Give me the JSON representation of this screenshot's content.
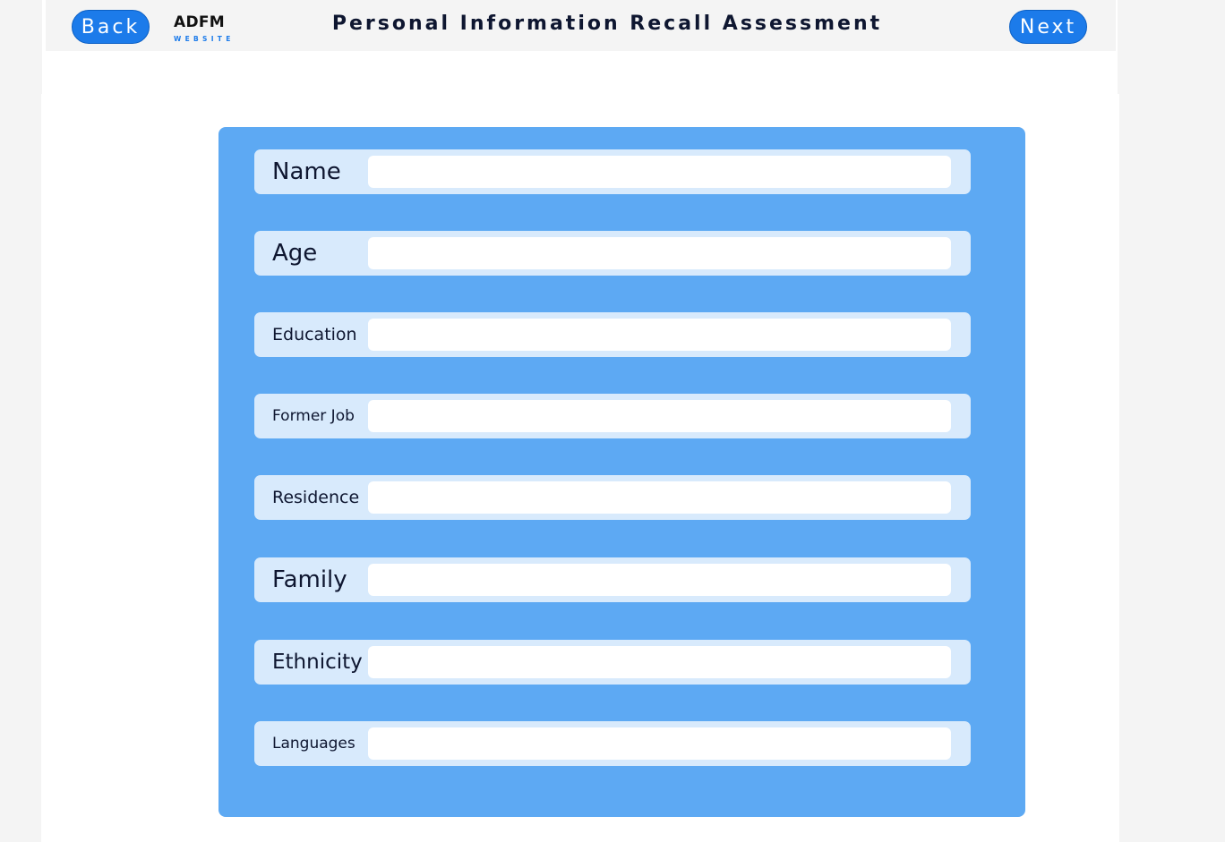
{
  "header": {
    "back_label": "Back",
    "next_label": "Next",
    "logo_main": "ADFM",
    "logo_sub": "WEBSITE",
    "title": "Personal Information Recall Assessment"
  },
  "form": {
    "fields": [
      {
        "label": "Name",
        "value": "",
        "placeholder": ""
      },
      {
        "label": "Age",
        "value": "",
        "placeholder": ""
      },
      {
        "label": "Education",
        "value": "",
        "placeholder": ""
      },
      {
        "label": "Former Job",
        "value": "",
        "placeholder": ""
      },
      {
        "label": "Residence",
        "value": "",
        "placeholder": ""
      },
      {
        "label": "Family",
        "value": "",
        "placeholder": ""
      },
      {
        "label": "Ethnicity",
        "value": "",
        "placeholder": ""
      },
      {
        "label": "Languages",
        "value": "",
        "placeholder": ""
      }
    ]
  },
  "colors": {
    "accent": "#1c7bea",
    "panel": "#5da9f3",
    "row": "#d8eafc",
    "text": "#0e1630",
    "background": "#f4f4f4"
  }
}
